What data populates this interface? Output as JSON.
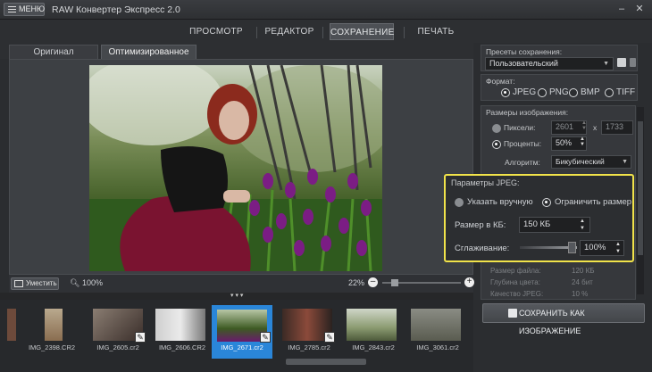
{
  "app": {
    "menu_label": "МЕНЮ",
    "title": "RAW Конвертер Экспресс 2.0"
  },
  "window_controls": {
    "minimize": "–",
    "close": "✕"
  },
  "nav": {
    "tabs": [
      "ПРОСМОТР",
      "РЕДАКТОР",
      "СОХРАНЕНИЕ",
      "ПЕЧАТЬ"
    ]
  },
  "view_tabs": {
    "original": "Оригинал",
    "optimized": "Оптимизированное"
  },
  "zoom": {
    "fit_label": "Уместить",
    "zoom_left": "100%",
    "zoom_right": "22%"
  },
  "filmstrip": {
    "items": [
      {
        "name": "IMG_2398.CR2"
      },
      {
        "name": "IMG_2605.cr2"
      },
      {
        "name": "IMG_2606.CR2"
      },
      {
        "name": "IMG_2671.cr2"
      },
      {
        "name": "IMG_2785.cr2"
      },
      {
        "name": "IMG_2843.cr2"
      },
      {
        "name": "IMG_3061.cr2"
      }
    ],
    "selected_index": 3,
    "collapse_glyph": "▾ ▾ ▾"
  },
  "panel": {
    "presets_label": "Пресеты сохранения:",
    "preset_value": "Пользовательский",
    "format_label": "Формат:",
    "formats": [
      "JPEG",
      "PNG",
      "BMP",
      "TIFF"
    ],
    "format_selected": "JPEG",
    "image_size_label": "Размеры изображения:",
    "pixels_label": "Пиксели:",
    "width_value": "2601",
    "x_sep": "x",
    "height_value": "1733",
    "percent_label": "Проценты:",
    "percent_value": "50%",
    "algorithm_label": "Алгоритм:",
    "algorithm_value": "Бикубический",
    "jpeg_params_label": "Параметры JPEG:",
    "manual_label": "Указать вручную",
    "limit_label": "Ограничить размер",
    "size_kb_label": "Размер в КБ:",
    "size_kb_value": "150 КБ",
    "smoothing_label": "Сглаживание:",
    "smoothing_value": "100%",
    "file_size_label": "Размер файла:",
    "file_size_value": "120 КБ",
    "color_depth_label": "Глубина цвета:",
    "color_depth_value": "24 бит",
    "jpeg_quality_label": "Качество JPEG:",
    "jpeg_quality_value": "10 %",
    "save_button": "СОХРАНИТЬ КАК ИЗОБРАЖЕНИЕ"
  }
}
